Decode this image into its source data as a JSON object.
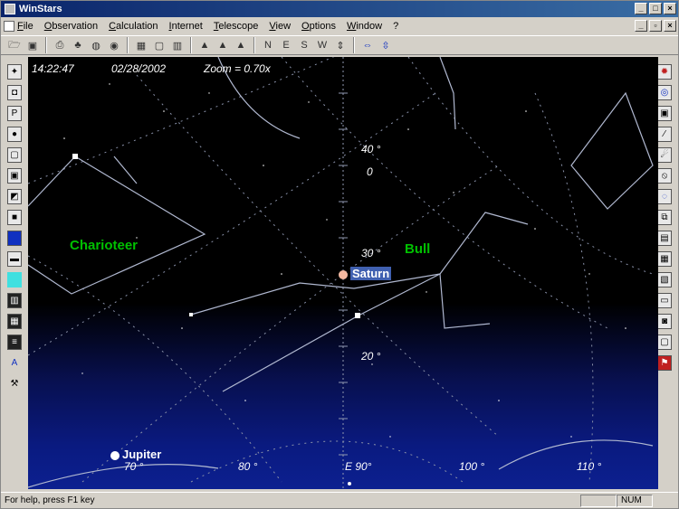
{
  "window": {
    "title": "WinStars"
  },
  "menu": {
    "items": [
      "File",
      "Observation",
      "Calculation",
      "Internet",
      "Telescope",
      "View",
      "Options",
      "Window",
      "?"
    ]
  },
  "toolbar": {
    "buttons": [
      {
        "name": "open-icon",
        "glyph": "🗁"
      },
      {
        "name": "save-icon",
        "glyph": "▣"
      },
      {
        "name": "print-icon",
        "glyph": "⎙"
      },
      {
        "name": "tree-icon",
        "glyph": "♣"
      },
      {
        "name": "world-icon",
        "glyph": "◍"
      },
      {
        "name": "globe-icon",
        "glyph": "◉"
      },
      {
        "name": "grid-icon",
        "glyph": "▦"
      },
      {
        "name": "frame-icon",
        "glyph": "▢"
      },
      {
        "name": "chart-icon",
        "glyph": "▥"
      },
      {
        "name": "mountain-icon",
        "glyph": "▲"
      },
      {
        "name": "hill-icon",
        "glyph": "▲"
      },
      {
        "name": "peak-icon",
        "glyph": "▲"
      },
      {
        "name": "north-button",
        "glyph": "N"
      },
      {
        "name": "east-button",
        "glyph": "E"
      },
      {
        "name": "south-button",
        "glyph": "S"
      },
      {
        "name": "west-button",
        "glyph": "W"
      },
      {
        "name": "zenith-button",
        "glyph": "⇕"
      },
      {
        "name": "left-right-arrows-icon",
        "glyph": "⇔"
      },
      {
        "name": "up-down-arrows-icon",
        "glyph": "⇳"
      }
    ]
  },
  "sky": {
    "time": "14:22:47",
    "date": "02/28/2002",
    "zoom": "Zoom = 0.70x",
    "constellations": [
      {
        "name": "Charioteer",
        "color": "#00c000"
      },
      {
        "name": "Bull",
        "color": "#00c000"
      }
    ],
    "planets": [
      {
        "name": "Saturn"
      },
      {
        "name": "Jupiter"
      }
    ],
    "altitude_labels": [
      "40 °",
      "0",
      "30 °",
      "20 °"
    ],
    "azimuth_labels": [
      "70 °",
      "80 °",
      "100 °",
      "110 °"
    ],
    "azimuth_center": "E 90°"
  },
  "status": {
    "message": "For help, press F1 key",
    "panel": "NUM"
  }
}
